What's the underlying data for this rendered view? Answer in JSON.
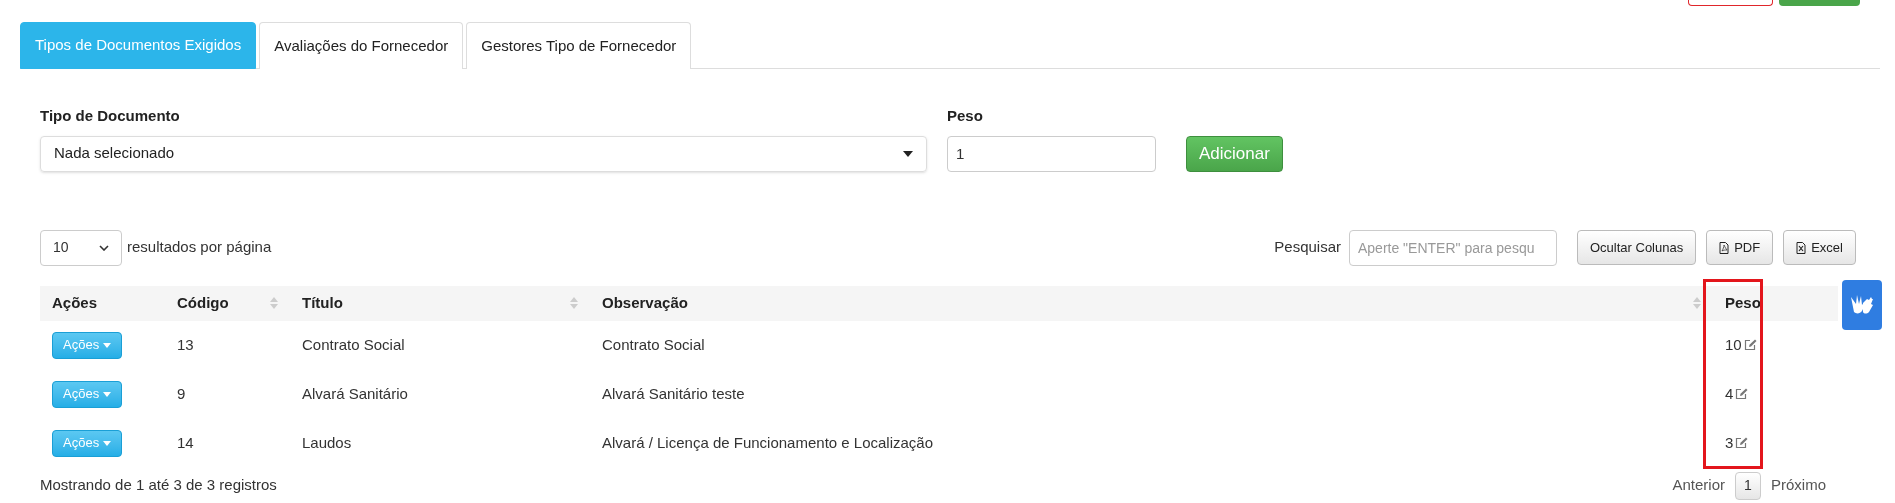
{
  "top_buttons": [
    {
      "kind": "danger"
    },
    {
      "kind": "success"
    }
  ],
  "tabs": [
    {
      "label": "Tipos de Documentos Exigidos",
      "selected": true
    },
    {
      "label": "Avaliações do Fornecedor",
      "selected": false
    },
    {
      "label": "Gestores Tipo de Fornecedor",
      "selected": false
    }
  ],
  "form": {
    "document_type": {
      "label": "Tipo de Documento",
      "value": "Nada selecionado"
    },
    "weight": {
      "label": "Peso",
      "value": "1"
    },
    "add_button": "Adicionar"
  },
  "table_controls": {
    "page_size": "10",
    "page_size_label": "resultados por página",
    "search_label": "Pesquisar",
    "search_placeholder": "Aperte \"ENTER\" para pesqu",
    "buttons": [
      {
        "label": "Ocultar Colunas",
        "kind": "plain"
      },
      {
        "label": "PDF",
        "kind": "pdf"
      },
      {
        "label": "Excel",
        "kind": "excel"
      }
    ]
  },
  "table": {
    "columns": [
      {
        "label": "Ações",
        "sortable": false,
        "highlighted": false
      },
      {
        "label": "Código",
        "sortable": true,
        "highlighted": false
      },
      {
        "label": "Título",
        "sortable": true,
        "highlighted": false
      },
      {
        "label": "Observação",
        "sortable": true,
        "highlighted": false
      },
      {
        "label": "Peso",
        "sortable": false,
        "highlighted": true
      }
    ],
    "rows": [
      {
        "actions": "Ações",
        "code": "13",
        "title": "Contrato Social",
        "note": "Contrato Social",
        "weight": "10"
      },
      {
        "actions": "Ações",
        "code": "9",
        "title": "Alvará Sanitário",
        "note": "Alvará Sanitário teste",
        "weight": "4"
      },
      {
        "actions": "Ações",
        "code": "14",
        "title": "Laudos",
        "note": "Alvará / Licença de Funcionamento e Localização",
        "weight": "3"
      }
    ]
  },
  "footer": {
    "info": "Mostrando de 1 até 3 de 3 registros",
    "previous": "Anterior",
    "pages": [
      {
        "label": "1",
        "selected": true
      }
    ],
    "next": "Próximo"
  }
}
